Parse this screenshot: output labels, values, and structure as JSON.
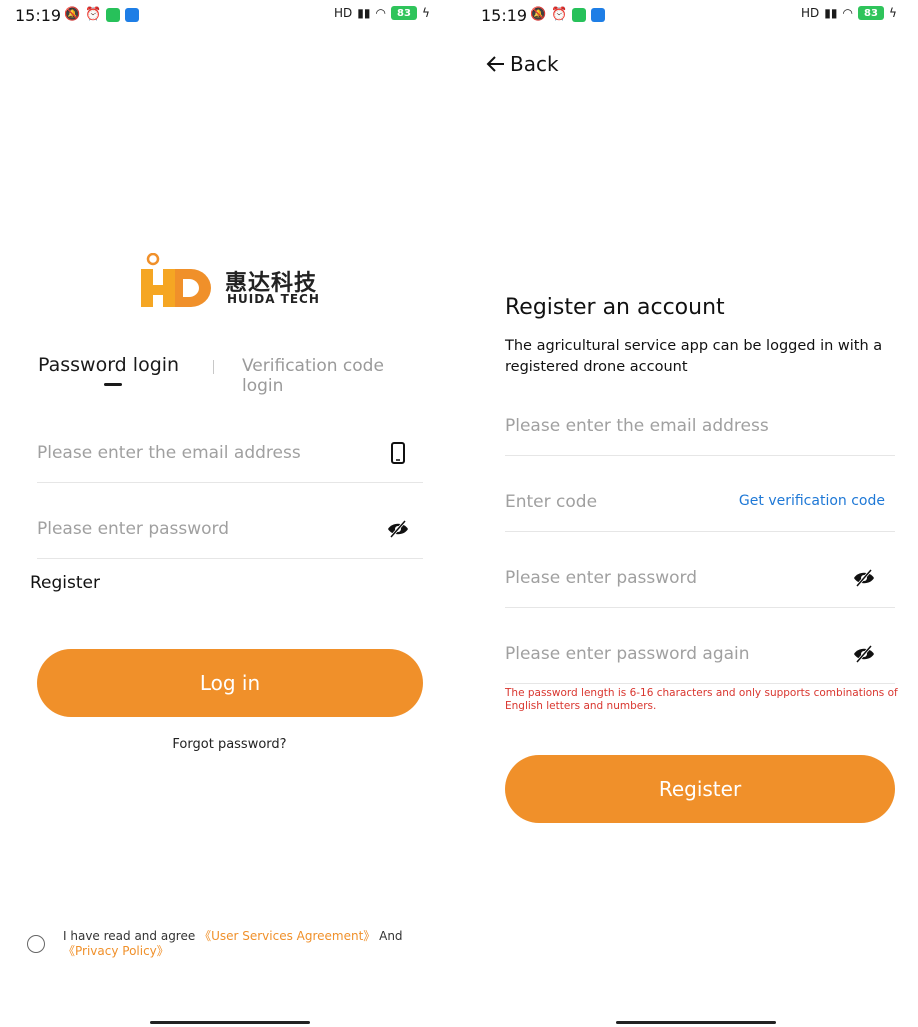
{
  "status": {
    "time": "15:19",
    "battery": "83",
    "network": "HD"
  },
  "login": {
    "logo_cn": "惠达科技",
    "logo_en": "HUIDA TECH",
    "tab_password": "Password login",
    "tab_code": "Verification code login",
    "email_placeholder": "Please enter the email address",
    "password_placeholder": "Please enter password",
    "register_link": "Register",
    "login_button": "Log in",
    "forgot": "Forgot password?",
    "agree_prefix": "I have read and agree ",
    "user_agreement": "《User Services Agreement》",
    "agree_and": " And ",
    "privacy": "《Privacy Policy》"
  },
  "register": {
    "back": "Back",
    "title": "Register an account",
    "subtitle": "The agricultural service app can be logged in with a registered drone account",
    "email_placeholder": "Please enter the email address",
    "code_placeholder": "Enter code",
    "get_code": "Get verification code",
    "password_placeholder": "Please enter password",
    "password_again_placeholder": "Please enter password again",
    "hint": "The password length is 6-16 characters and only supports combinations of English letters and numbers.",
    "register_button": "Register"
  },
  "colors": {
    "accent": "#f0902a",
    "link": "#1e78d6",
    "error": "#d9362f"
  },
  "icons": [
    "back-arrow-icon",
    "phone-icon",
    "eye-off-icon",
    "radio-icon",
    "alarm-icon",
    "wifi-icon",
    "battery-icon"
  ]
}
